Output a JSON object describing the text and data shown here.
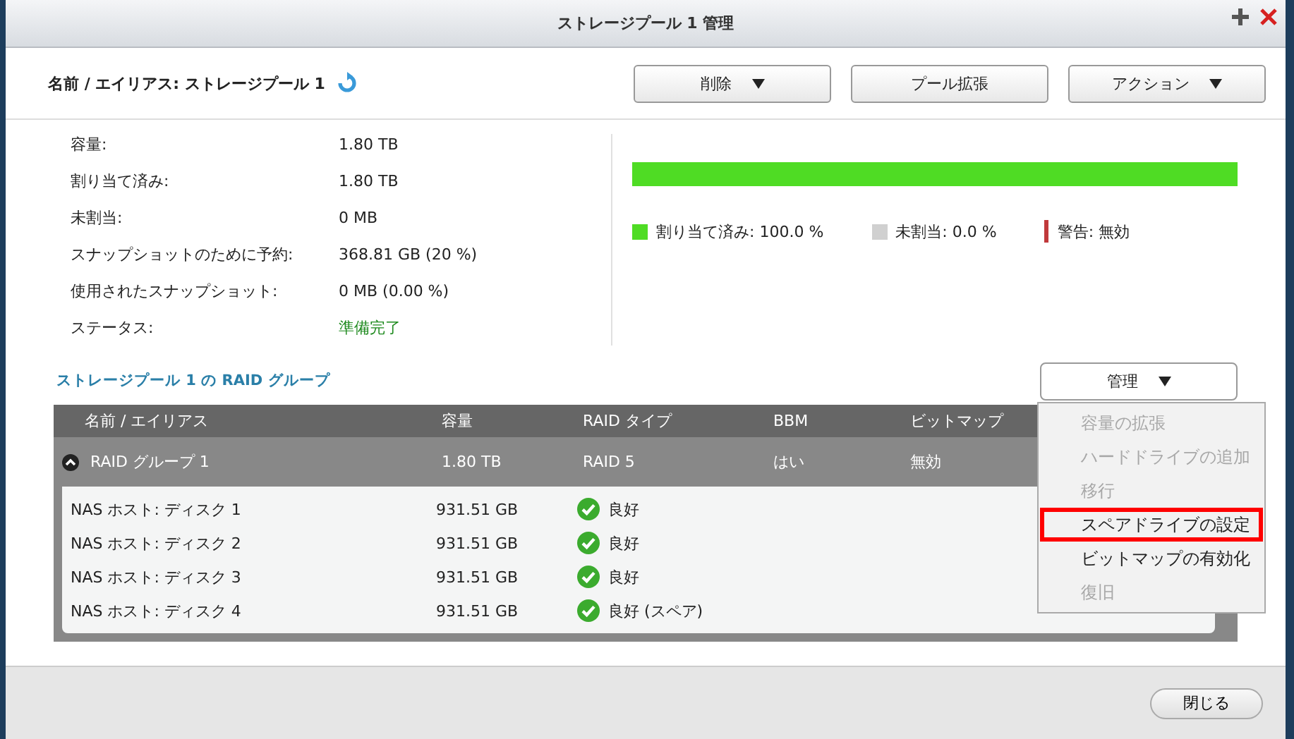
{
  "window": {
    "title": "ストレージプール 1 管理"
  },
  "header": {
    "name_label": "名前 / エイリアス: ストレージプール 1",
    "buttons": [
      {
        "label": "削除",
        "caret": true
      },
      {
        "label": "プール拡張",
        "caret": false
      },
      {
        "label": "アクション",
        "caret": true
      }
    ]
  },
  "info": [
    {
      "label": "容量:",
      "value": "1.80 TB",
      "kind": "plain"
    },
    {
      "label": "割り当て済み:",
      "value": "1.80 TB",
      "kind": "plain"
    },
    {
      "label": "未割当:",
      "value": "0 MB",
      "kind": "plain"
    },
    {
      "label": "スナップショットのために予約:",
      "value": "368.81 GB (20 %)",
      "kind": "plain"
    },
    {
      "label": "使用されたスナップショット:",
      "value": "0 MB (0.00 %)",
      "kind": "plain"
    },
    {
      "label": "ステータス:",
      "value": "準備完了",
      "kind": "status"
    }
  ],
  "usage": {
    "level": 1.0,
    "legend": [
      {
        "label": "割り当て済み: 100.0 %",
        "color": "#4fdc24",
        "kind": "square"
      },
      {
        "label": "未割当: 0.0 %",
        "color": "#d0d0d0",
        "kind": "square"
      },
      {
        "label": "警告: 無効",
        "color": "#c0393b",
        "kind": "line"
      }
    ]
  },
  "raid": {
    "title": "ストレージプール 1 の RAID グループ",
    "manage_button": {
      "label": "管理",
      "caret": true
    },
    "columns": [
      "名前 / エイリアス",
      "容量",
      "RAID タイプ",
      "BBM",
      "ビットマップ"
    ],
    "group": {
      "name": "RAID グループ 1",
      "capacity": "1.80 TB",
      "raid_type": "RAID 5",
      "bbm": "はい",
      "bitmap": "無効",
      "expanded": true
    },
    "disks": [
      {
        "name": "NAS ホスト: ディスク 1",
        "capacity": "931.51 GB",
        "status": "良好"
      },
      {
        "name": "NAS ホスト: ディスク 2",
        "capacity": "931.51 GB",
        "status": "良好"
      },
      {
        "name": "NAS ホスト: ディスク 3",
        "capacity": "931.51 GB",
        "status": "良好"
      },
      {
        "name": "NAS ホスト: ディスク 4",
        "capacity": "931.51 GB",
        "status": "良好 (スペア)"
      }
    ],
    "menu": [
      {
        "label": "容量の拡張",
        "disabled": true,
        "highlighted": false
      },
      {
        "label": "ハードドライブの追加",
        "disabled": true,
        "highlighted": false
      },
      {
        "label": "移行",
        "disabled": true,
        "highlighted": false
      },
      {
        "label": "スペアドライブの設定",
        "disabled": false,
        "highlighted": true
      },
      {
        "label": "ビットマップの有効化",
        "disabled": false,
        "highlighted": false
      },
      {
        "label": "復旧",
        "disabled": true,
        "highlighted": false
      }
    ]
  },
  "footer": {
    "close_button": "閉じる"
  }
}
